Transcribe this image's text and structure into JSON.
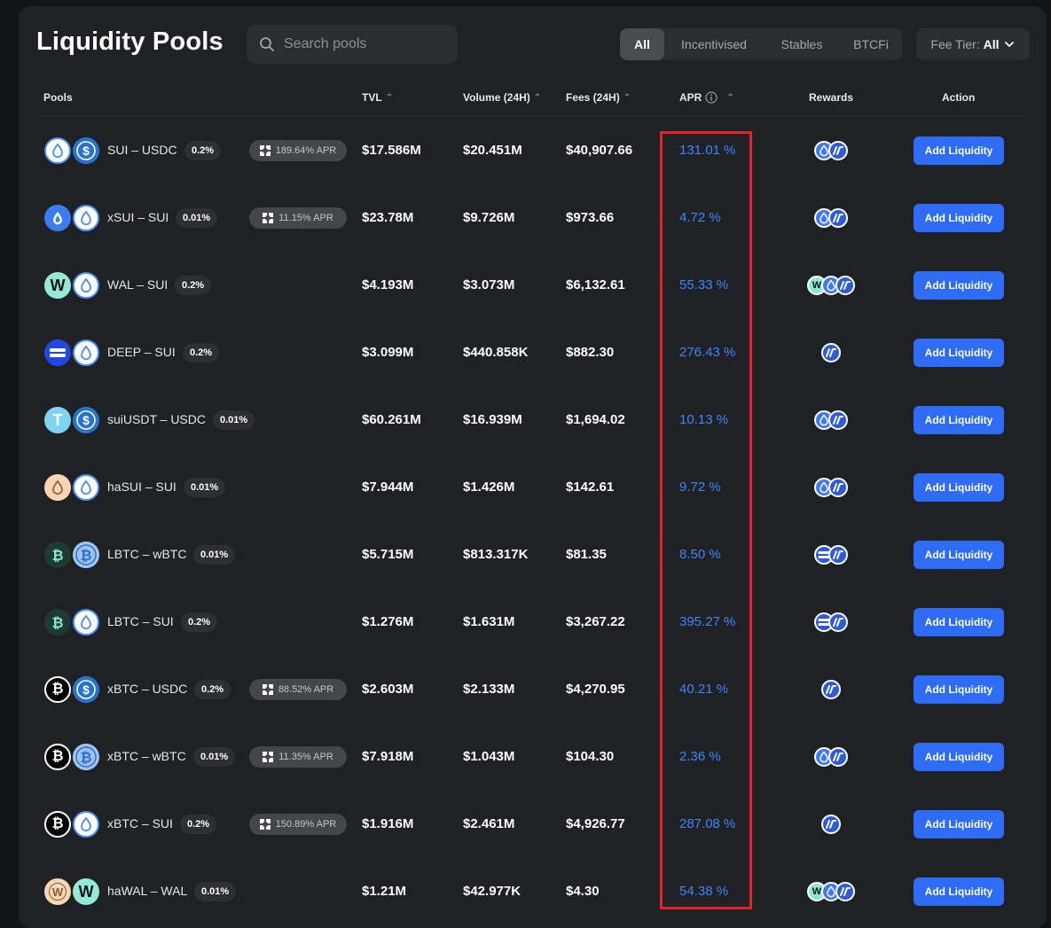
{
  "title": "Liquidity Pools",
  "search": {
    "placeholder": "Search pools"
  },
  "filters": [
    {
      "label": "All",
      "active": true
    },
    {
      "label": "Incentivised",
      "active": false
    },
    {
      "label": "Stables",
      "active": false
    },
    {
      "label": "BTCFi",
      "active": false
    }
  ],
  "fee_tier": {
    "label": "Fee Tier:",
    "value": "All"
  },
  "columns": {
    "pools": "Pools",
    "tvl": "TVL",
    "volume": "Volume (24H)",
    "fees": "Fees (24H)",
    "apr": "APR",
    "rewards": "Rewards",
    "action": "Action"
  },
  "add_label": "Add Liquidity",
  "rows": [
    {
      "pair": "SUI – USDC",
      "fee": "0.2%",
      "incentive": "189.64% APR",
      "tvl": "$17.586M",
      "volume": "$20.451M",
      "fees": "$40,907.66",
      "apr": "131.01 %",
      "tokens": [
        "sui",
        "usdc"
      ],
      "rewards": [
        "sui",
        "pill"
      ]
    },
    {
      "pair": "xSUI – SUI",
      "fee": "0.01%",
      "incentive": "11.15% APR",
      "tvl": "$23.78M",
      "volume": "$9.726M",
      "fees": "$973.66",
      "apr": "4.72 %",
      "tokens": [
        "xsui",
        "sui"
      ],
      "rewards": [
        "sui",
        "pill"
      ]
    },
    {
      "pair": "WAL – SUI",
      "fee": "0.2%",
      "incentive": "",
      "tvl": "$4.193M",
      "volume": "$3.073M",
      "fees": "$6,132.61",
      "apr": "55.33 %",
      "tokens": [
        "wal",
        "sui"
      ],
      "rewards": [
        "wal",
        "sui",
        "pill"
      ]
    },
    {
      "pair": "DEEP – SUI",
      "fee": "0.2%",
      "incentive": "",
      "tvl": "$3.099M",
      "volume": "$440.858K",
      "fees": "$882.30",
      "apr": "276.43 %",
      "tokens": [
        "deep",
        "sui"
      ],
      "rewards": [
        "pill"
      ]
    },
    {
      "pair": "suiUSDT – USDC",
      "fee": "0.01%",
      "incentive": "",
      "tvl": "$60.261M",
      "volume": "$16.939M",
      "fees": "$1,694.02",
      "apr": "10.13 %",
      "tokens": [
        "usdt",
        "usdc"
      ],
      "rewards": [
        "sui",
        "pill"
      ]
    },
    {
      "pair": "haSUI – SUI",
      "fee": "0.01%",
      "incentive": "",
      "tvl": "$7.944M",
      "volume": "$1.426M",
      "fees": "$142.61",
      "apr": "9.72 %",
      "tokens": [
        "hasui",
        "sui"
      ],
      "rewards": [
        "sui",
        "pill"
      ]
    },
    {
      "pair": "LBTC – wBTC",
      "fee": "0.01%",
      "incentive": "",
      "tvl": "$5.715M",
      "volume": "$813.317K",
      "fees": "$81.35",
      "apr": "8.50 %",
      "tokens": [
        "lbtc",
        "wbtc"
      ],
      "rewards": [
        "deep",
        "pill"
      ]
    },
    {
      "pair": "LBTC – SUI",
      "fee": "0.2%",
      "incentive": "",
      "tvl": "$1.276M",
      "volume": "$1.631M",
      "fees": "$3,267.22",
      "apr": "395.27 %",
      "tokens": [
        "lbtc",
        "sui"
      ],
      "rewards": [
        "deep",
        "pill"
      ]
    },
    {
      "pair": "xBTC – USDC",
      "fee": "0.2%",
      "incentive": "88.52% APR",
      "tvl": "$2.603M",
      "volume": "$2.133M",
      "fees": "$4,270.95",
      "apr": "40.21 %",
      "tokens": [
        "xbtc",
        "usdc"
      ],
      "rewards": [
        "pill"
      ]
    },
    {
      "pair": "xBTC – wBTC",
      "fee": "0.01%",
      "incentive": "11.35% APR",
      "tvl": "$7.918M",
      "volume": "$1.043M",
      "fees": "$104.30",
      "apr": "2.36 %",
      "tokens": [
        "xbtc",
        "wbtc"
      ],
      "rewards": [
        "sui",
        "pill"
      ]
    },
    {
      "pair": "xBTC – SUI",
      "fee": "0.2%",
      "incentive": "150.89% APR",
      "tvl": "$1.916M",
      "volume": "$2.461M",
      "fees": "$4,926.77",
      "apr": "287.08 %",
      "tokens": [
        "xbtc",
        "sui"
      ],
      "rewards": [
        "pill"
      ]
    },
    {
      "pair": "haWAL – WAL",
      "fee": "0.01%",
      "incentive": "",
      "tvl": "$1.21M",
      "volume": "$42.977K",
      "fees": "$4.30",
      "apr": "54.38 %",
      "tokens": [
        "hawal",
        "wal"
      ],
      "rewards": [
        "wal",
        "sui",
        "pill"
      ]
    }
  ]
}
